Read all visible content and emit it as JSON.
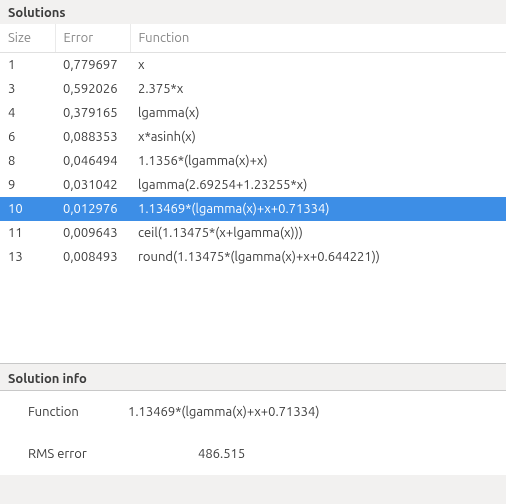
{
  "solutions": {
    "title": "Solutions",
    "headers": {
      "size": "Size",
      "error": "Error",
      "function": "Function"
    },
    "rows": [
      {
        "size": "1",
        "error": "0,779697",
        "func": "x",
        "selected": false
      },
      {
        "size": "3",
        "error": "0,592026",
        "func": "2.375*x",
        "selected": false
      },
      {
        "size": "4",
        "error": "0,379165",
        "func": "lgamma(x)",
        "selected": false
      },
      {
        "size": "6",
        "error": "0,088353",
        "func": "x*asinh(x)",
        "selected": false
      },
      {
        "size": "8",
        "error": "0,046494",
        "func": "1.1356*(lgamma(x)+x)",
        "selected": false
      },
      {
        "size": "9",
        "error": "0,031042",
        "func": "lgamma(2.69254+1.23255*x)",
        "selected": false
      },
      {
        "size": "10",
        "error": "0,012976",
        "func": "1.13469*(lgamma(x)+x+0.71334)",
        "selected": true
      },
      {
        "size": "11",
        "error": "0,009643",
        "func": "ceil(1.13475*(x+lgamma(x)))",
        "selected": false
      },
      {
        "size": "13",
        "error": "0,008493",
        "func": "round(1.13475*(lgamma(x)+x+0.644221))",
        "selected": false
      }
    ]
  },
  "info": {
    "title": "Solution info",
    "function_label": "Function",
    "function_value": "1.13469*(lgamma(x)+x+0.71334)",
    "rms_label": "RMS error",
    "rms_value": "486.515"
  }
}
